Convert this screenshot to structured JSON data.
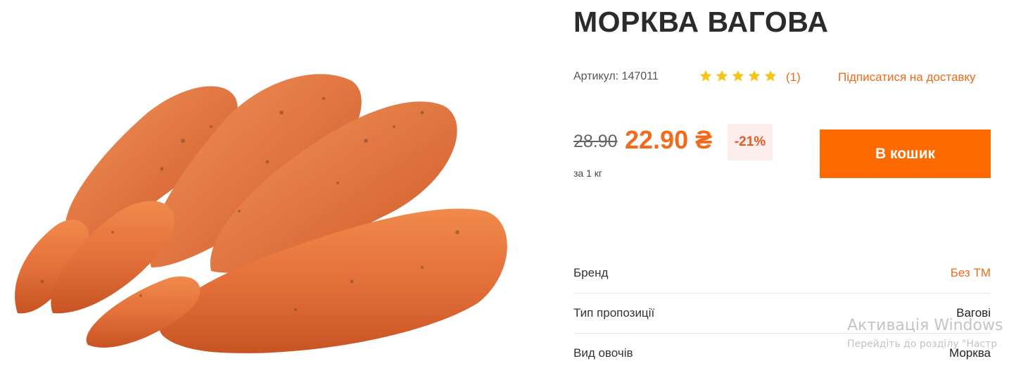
{
  "product": {
    "title": "МОРКВА ВАГОВА",
    "sku": "Артикул: 147011",
    "rating_stars": 5,
    "review_count": "(1)",
    "subscribe_link": "Підписатися на доставку",
    "old_price": "28.90",
    "new_price": "22.90 ₴",
    "discount": "-21%",
    "unit": "за 1 кг",
    "cart_button": "В кошик"
  },
  "specs": [
    {
      "label": "Бренд",
      "value": "Без ТМ"
    },
    {
      "label": "Тип пропозиції",
      "value": "Вагові"
    },
    {
      "label": "Вид овочів",
      "value": "Морква"
    }
  ],
  "watermark": {
    "title": "Активація Windows",
    "subtitle": "Перейдіть до розділу \"Настр"
  },
  "colors": {
    "accent": "#ff6a00",
    "price": "#f26a1b",
    "star": "#f5c518",
    "discount_bg": "#fdeeee"
  },
  "icons": {
    "star": "star-icon",
    "product_image": "carrot-image"
  }
}
